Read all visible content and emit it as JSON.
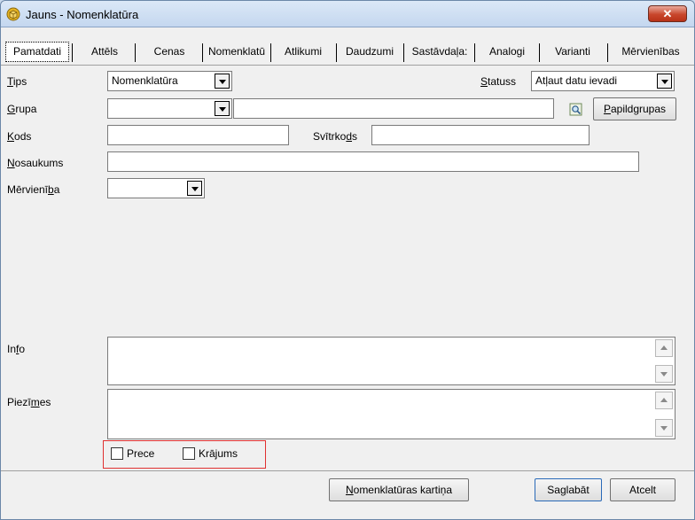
{
  "window": {
    "title": "Jauns - Nomenklatūra",
    "close_label": "✕",
    "colors": {
      "titlebar": "#c4d7ef",
      "close": "#c8462c",
      "highlight": "#e03030"
    }
  },
  "tabs": [
    {
      "label": "Pamatdati",
      "active": true
    },
    {
      "label": "Attēls"
    },
    {
      "label": "Cenas"
    },
    {
      "label": "Nomenklatū"
    },
    {
      "label": "Atlikumi"
    },
    {
      "label": "Daudzumi"
    },
    {
      "label": "Sastāvdaļa:"
    },
    {
      "label": "Analogi"
    },
    {
      "label": "Varianti"
    },
    {
      "label": "Mērvienības"
    }
  ],
  "form": {
    "tips": {
      "label_first": "T",
      "label_rest": "ips",
      "value": "Nomenklatūra"
    },
    "statuss": {
      "label_first": "S",
      "label_rest": "tatuss",
      "value": "Atļaut datu ievadi"
    },
    "grupa": {
      "label_first": "G",
      "label_rest": "rupa",
      "value": "",
      "text": ""
    },
    "papildgrupas": {
      "label_first": "P",
      "label_rest": "apildgrupas"
    },
    "kods": {
      "label_first": "K",
      "label_rest": "ods",
      "value": ""
    },
    "svitrkods": {
      "label_pre": "Svītrko",
      "label_u": "d",
      "label_post": "s",
      "value": ""
    },
    "nosaukums": {
      "label_first": "N",
      "label_rest": "osaukums",
      "value": ""
    },
    "mervieniba": {
      "label_pre": "Mērvienī",
      "label_u": "b",
      "label_post": "a",
      "value": ""
    },
    "info": {
      "label_pre": "In",
      "label_u": "f",
      "label_post": "o",
      "value": ""
    },
    "piezimes": {
      "label_pre": "Piezī",
      "label_u": "m",
      "label_post": "es",
      "value": ""
    }
  },
  "checkboxes": [
    {
      "label": "Prece",
      "checked": false
    },
    {
      "label": "Krājums",
      "checked": false
    }
  ],
  "footer": {
    "card_pre": "",
    "card_u": "N",
    "card_post": "omenklatūras kartiņa",
    "save_pre": "Sa",
    "save_u": "g",
    "save_post": "labāt",
    "cancel": "Atcelt"
  }
}
